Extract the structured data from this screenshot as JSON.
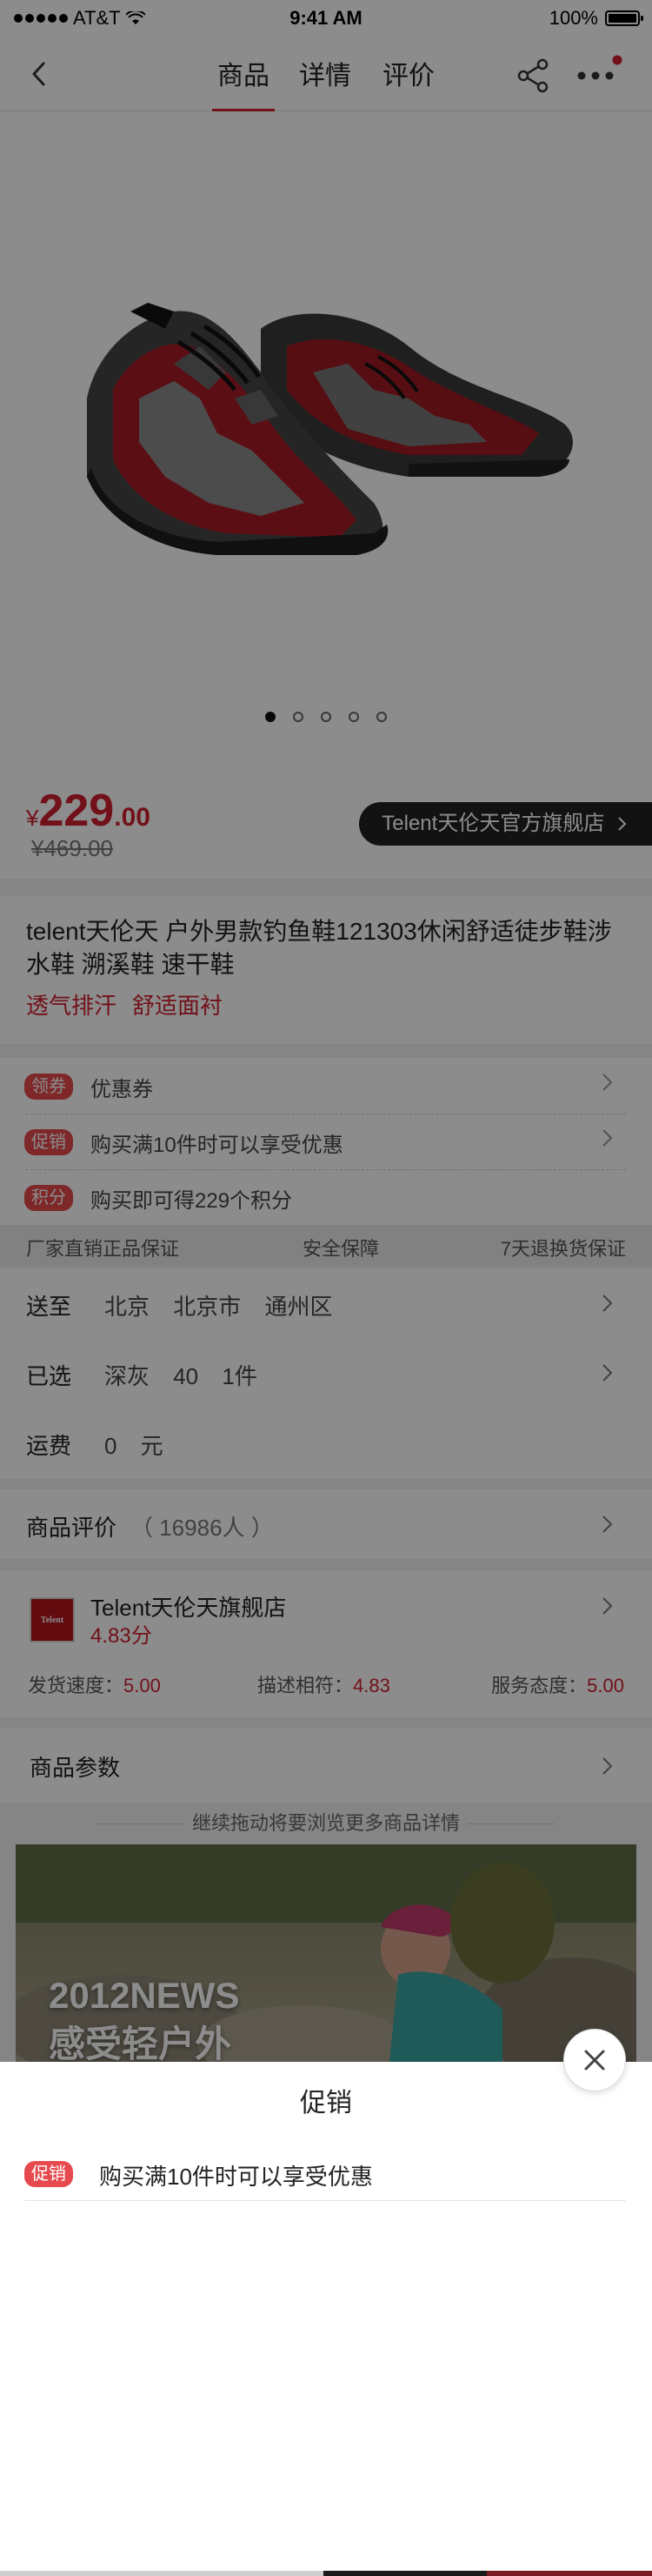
{
  "status_bar": {
    "carrier": "AT&T",
    "time": "9:41 AM",
    "battery": "100%"
  },
  "nav": {
    "tabs": [
      "商品",
      "详情",
      "评价"
    ],
    "active_tab": "商品"
  },
  "carousel": {
    "count": 5,
    "active_index": 0
  },
  "price": {
    "currency": "¥",
    "integer": "229",
    "decimal": ".00",
    "original": "¥469.00"
  },
  "store_button": "Telent天伦天官方旗舰店",
  "product": {
    "title": "telent天伦天 户外男款钓鱼鞋121303休闲舒适徒步鞋涉水鞋 溯溪鞋 速干鞋",
    "tags": [
      "透气排汗",
      "舒适面衬"
    ]
  },
  "promotions": [
    {
      "badge": "领券",
      "text": "优惠券"
    },
    {
      "badge": "促销",
      "text": "购买满10件时可以享受优惠"
    },
    {
      "badge": "积分",
      "text": "购买即可得229个积分"
    }
  ],
  "guarantees": [
    "厂家直销正品保证",
    "安全保障",
    "7天退换货保证"
  ],
  "delivery": {
    "ship_to_label": "送至",
    "ship_to_value": "北京 北京市 通州区",
    "selected_label": "已选",
    "selected_value": "深灰 40 1件",
    "freight_label": "运费",
    "freight_value": "0 元"
  },
  "reviews": {
    "label": "商品评价",
    "count": "（ 16986人 ）"
  },
  "shop": {
    "logo_text": "Telent",
    "name": "Telent天伦天旗舰店",
    "score": "4.83分",
    "ratings": [
      {
        "label": "发货速度：",
        "value": "5.00"
      },
      {
        "label": "描述相符：",
        "value": "4.83"
      },
      {
        "label": "服务态度：",
        "value": "5.00"
      }
    ]
  },
  "params_label": "商品参数",
  "continue_hint": "继续拖动将要浏览更多商品详情",
  "banner": {
    "line1": "2012NEWS",
    "line2": "感受轻户外"
  },
  "sheet": {
    "title": "促销",
    "items": [
      {
        "badge": "促销",
        "text": "购买满10件时可以享受优惠"
      }
    ]
  },
  "colors": {
    "accent": "#d0202e",
    "badge": "#e64a4e",
    "overlay": "rgba(0,0,0,0.45)"
  }
}
